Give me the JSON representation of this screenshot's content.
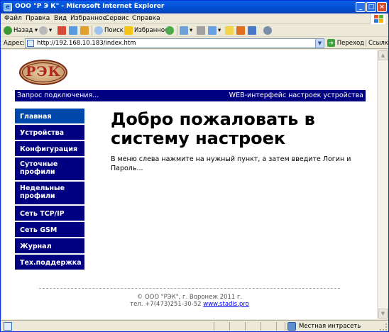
{
  "window": {
    "title": "ООО \"Р Э К\" - Microsoft Internet Explorer",
    "min_glyph": "_",
    "max_glyph": "□",
    "close_glyph": "×"
  },
  "menubar": {
    "items": [
      "Файл",
      "Правка",
      "Вид",
      "Избранное",
      "Сервис",
      "Справка"
    ]
  },
  "toolbar": {
    "back_label": "Назад",
    "search_label": "Поиск",
    "favorites_label": "Избранное"
  },
  "address": {
    "label": "Адрес:",
    "url": "http://192.168.10.183/index.htm",
    "go_label": "Переход",
    "links_label": "Ссылки"
  },
  "page": {
    "logo_text": "РЭК",
    "header_left": "Запрос подключения...",
    "header_right": "WEB-интерфейс настроек устройства",
    "nav": [
      {
        "label": "Главная",
        "active": true
      },
      {
        "label": "Устройства"
      },
      {
        "label": "Конфигурация"
      },
      {
        "label": "Суточные профили"
      },
      {
        "label": "Недельные профили"
      },
      {
        "label": "Сеть TCP/IP"
      },
      {
        "label": "Сеть GSM"
      },
      {
        "label": "Журнал"
      },
      {
        "label": "Тех.поддержка"
      }
    ],
    "welcome_title": "Добро пожаловать в систему настроек",
    "intro_text": "В меню слева нажмите на нужный пункт, а затем введите Логин и Пароль...",
    "footer_line1": "© ООО \"РЭК\", г. Воронеж 2011 г.",
    "footer_line2_prefix": "тел. +7(473)251-30-52",
    "footer_link": "www.stadis.pro"
  },
  "statusbar": {
    "zone": "Местная интрасеть"
  },
  "colors": {
    "nav_bg": "#000080",
    "nav_active_bg": "#0047ab",
    "header_bg": "#000080",
    "titlebar": "#0454d8"
  }
}
